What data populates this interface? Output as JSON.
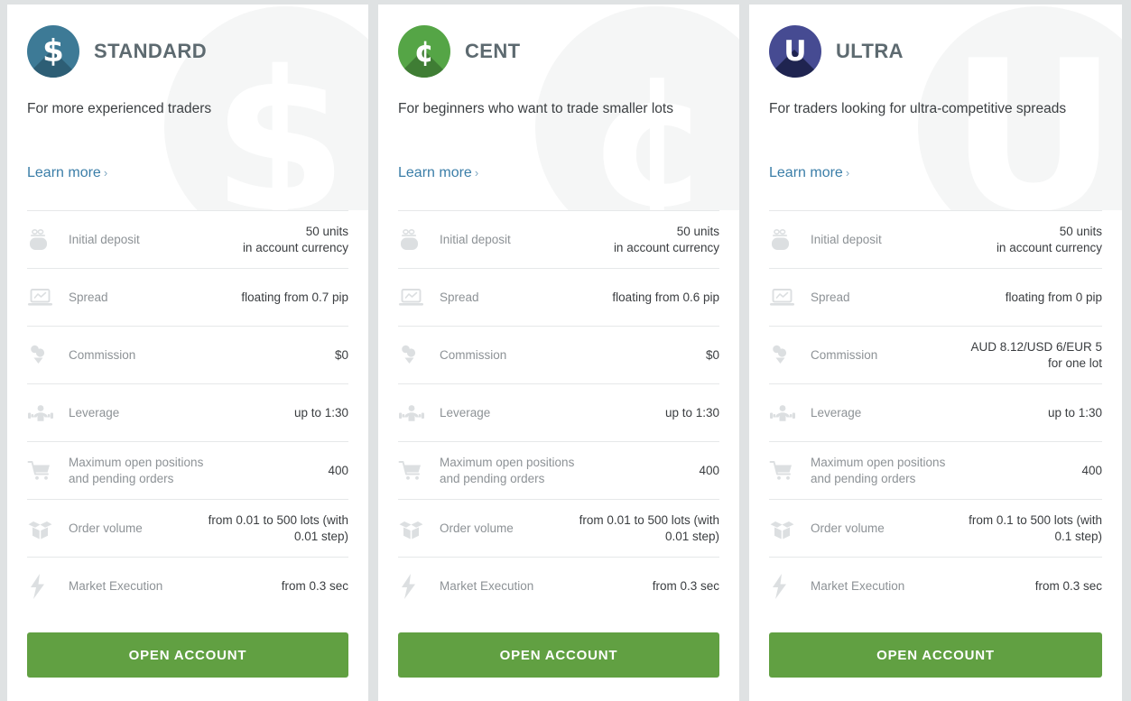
{
  "page": {
    "background_color": "#dfe2e3",
    "cta_color": "#61a042",
    "link_color": "#3b7ea8"
  },
  "cards": [
    {
      "id": "standard",
      "title": "STANDARD",
      "tagline": "For more experienced traders",
      "learn_more": "Learn more",
      "chevron": "›",
      "icon_name": "dollar-badge-icon",
      "icon_glyph": "$",
      "icon_color": "#3d7a96",
      "icon_shadow_color": "#2d5e75",
      "watermark_glyph": "$",
      "cta_label": "OPEN ACCOUNT",
      "rows": [
        {
          "icon": "piggy-bank-icon",
          "label": "Initial deposit",
          "value": "50 units\nin account currency"
        },
        {
          "icon": "laptop-chart-icon",
          "label": "Spread",
          "value": "floating from 0.7 pip"
        },
        {
          "icon": "commission-icon",
          "label": "Commission",
          "value": "$0"
        },
        {
          "icon": "weightlifter-icon",
          "label": "Leverage",
          "value": "up to 1:30"
        },
        {
          "icon": "shopping-cart-icon",
          "label": "Maximum open positions\nand pending orders",
          "value": "400"
        },
        {
          "icon": "open-box-icon",
          "label": "Order volume",
          "value": "from 0.01 to 500 lots (with 0.01 step)"
        },
        {
          "icon": "lightning-bolt-icon",
          "label": "Market Execution",
          "value": "from 0.3 sec"
        }
      ]
    },
    {
      "id": "cent",
      "title": "CENT",
      "tagline": "For beginners who want to trade smaller lots",
      "learn_more": "Learn more",
      "chevron": "›",
      "icon_name": "cent-badge-icon",
      "icon_glyph": "¢",
      "icon_color": "#55a546",
      "icon_shadow_color": "#3f7d34",
      "watermark_glyph": "¢",
      "cta_label": "OPEN ACCOUNT",
      "rows": [
        {
          "icon": "piggy-bank-icon",
          "label": "Initial deposit",
          "value": "50 units\nin account currency"
        },
        {
          "icon": "laptop-chart-icon",
          "label": "Spread",
          "value": "floating from 0.6 pip"
        },
        {
          "icon": "commission-icon",
          "label": "Commission",
          "value": "$0"
        },
        {
          "icon": "weightlifter-icon",
          "label": "Leverage",
          "value": "up to 1:30"
        },
        {
          "icon": "shopping-cart-icon",
          "label": "Maximum open positions\nand pending orders",
          "value": "400"
        },
        {
          "icon": "open-box-icon",
          "label": "Order volume",
          "value": "from 0.01 to 500 lots (with 0.01 step)"
        },
        {
          "icon": "lightning-bolt-icon",
          "label": "Market Execution",
          "value": "from 0.3 sec"
        }
      ]
    },
    {
      "id": "ultra",
      "title": "ULTRA",
      "tagline": "For traders looking for ultra-competitive spreads",
      "learn_more": "Learn more",
      "chevron": "›",
      "icon_name": "ultra-badge-icon",
      "icon_glyph": "U",
      "icon_color": "#464b92",
      "icon_shadow_color": "#1f2450",
      "watermark_glyph": "U",
      "cta_label": "OPEN ACCOUNT",
      "rows": [
        {
          "icon": "piggy-bank-icon",
          "label": "Initial deposit",
          "value": "50 units\nin account currency"
        },
        {
          "icon": "laptop-chart-icon",
          "label": "Spread",
          "value": "floating from 0 pip"
        },
        {
          "icon": "commission-icon",
          "label": "Commission",
          "value": "AUD 8.12/USD 6/EUR 5\nfor one lot"
        },
        {
          "icon": "weightlifter-icon",
          "label": "Leverage",
          "value": "up to 1:30"
        },
        {
          "icon": "shopping-cart-icon",
          "label": "Maximum open positions\nand pending orders",
          "value": "400"
        },
        {
          "icon": "open-box-icon",
          "label": "Order volume",
          "value": "from 0.1 to 500 lots (with 0.1 step)"
        },
        {
          "icon": "lightning-bolt-icon",
          "label": "Market Execution",
          "value": "from 0.3 sec"
        }
      ]
    }
  ]
}
